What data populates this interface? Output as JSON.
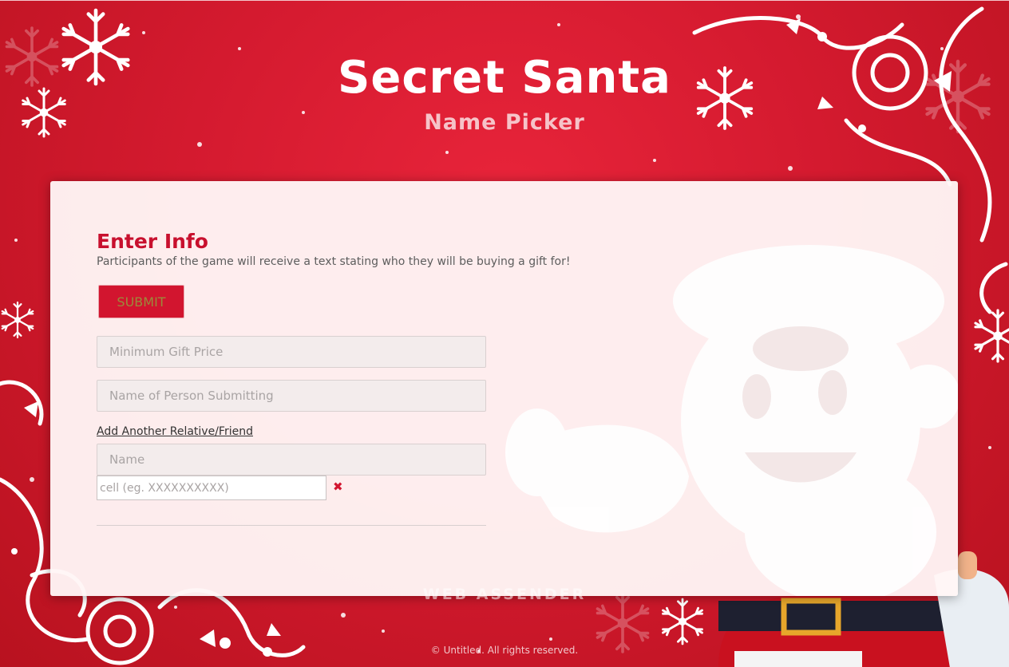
{
  "header": {
    "title": "Secret Santa",
    "subtitle": "Name Picker"
  },
  "form": {
    "section_title": "Enter Info",
    "description": "Participants of the game will receive a text stating who they will be buying a gift for!",
    "submit_label": "SUBMIT",
    "min_price_placeholder": "Minimum Gift Price",
    "submitter_placeholder": "Name of Person Submitting",
    "add_link_label": "Add Another Relative/Friend",
    "name_placeholder": "Name",
    "cell_placeholder": "cell (eg. XXXXXXXXXX)",
    "remove_glyph": "✖"
  },
  "watermark": "WEB ASSENDER",
  "footer": "© Untitled. All rights reserved.",
  "icons": [
    "snowflake-icon",
    "swirl-vine-icon",
    "santa-illustration",
    "remove-icon"
  ],
  "colors": {
    "background_red": "#d41a2f",
    "accent_red": "#c8102e",
    "card": "#fff6f6"
  }
}
